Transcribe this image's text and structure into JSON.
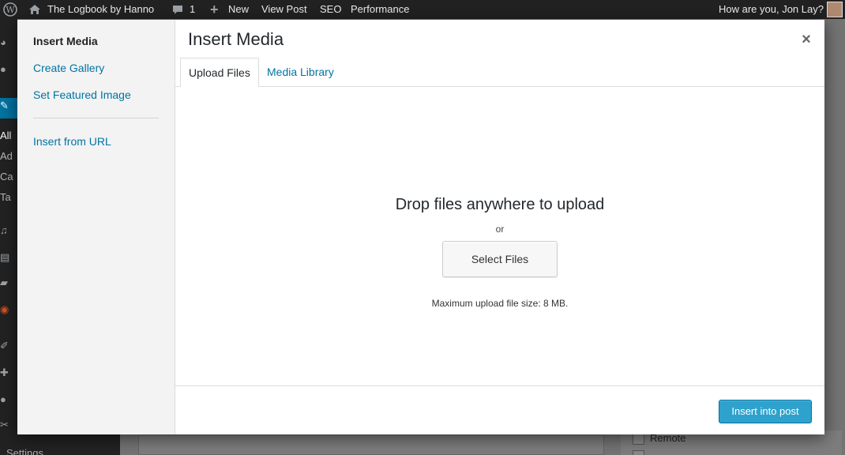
{
  "adminbar": {
    "site_title": "The Logbook by Hanno",
    "comments_count": "1",
    "new_label": "New",
    "view_post_label": "View Post",
    "seo_label": "SEO",
    "performance_label": "Performance",
    "greeting": "How are you, Jon Lay?"
  },
  "background": {
    "sidebar_items": [
      "All",
      "Ad",
      "Ca",
      "Ta"
    ],
    "settings_label": "Settings",
    "checkbox_label": "Remote"
  },
  "modal": {
    "menu": {
      "insert_media": "Insert Media",
      "create_gallery": "Create Gallery",
      "set_featured_image": "Set Featured Image",
      "insert_from_url": "Insert from URL"
    },
    "title": "Insert Media",
    "close_glyph": "×",
    "tabs": {
      "upload_files": "Upload Files",
      "media_library": "Media Library"
    },
    "uploader": {
      "drop_title": "Drop files anywhere to upload",
      "or": "or",
      "select_files": "Select Files",
      "max_size": "Maximum upload file size: 8 MB."
    },
    "toolbar": {
      "insert_button": "Insert into post"
    }
  },
  "colors": {
    "accent": "#0074a2",
    "primary_button": "#2ea2cc",
    "adminbar": "#222222"
  }
}
